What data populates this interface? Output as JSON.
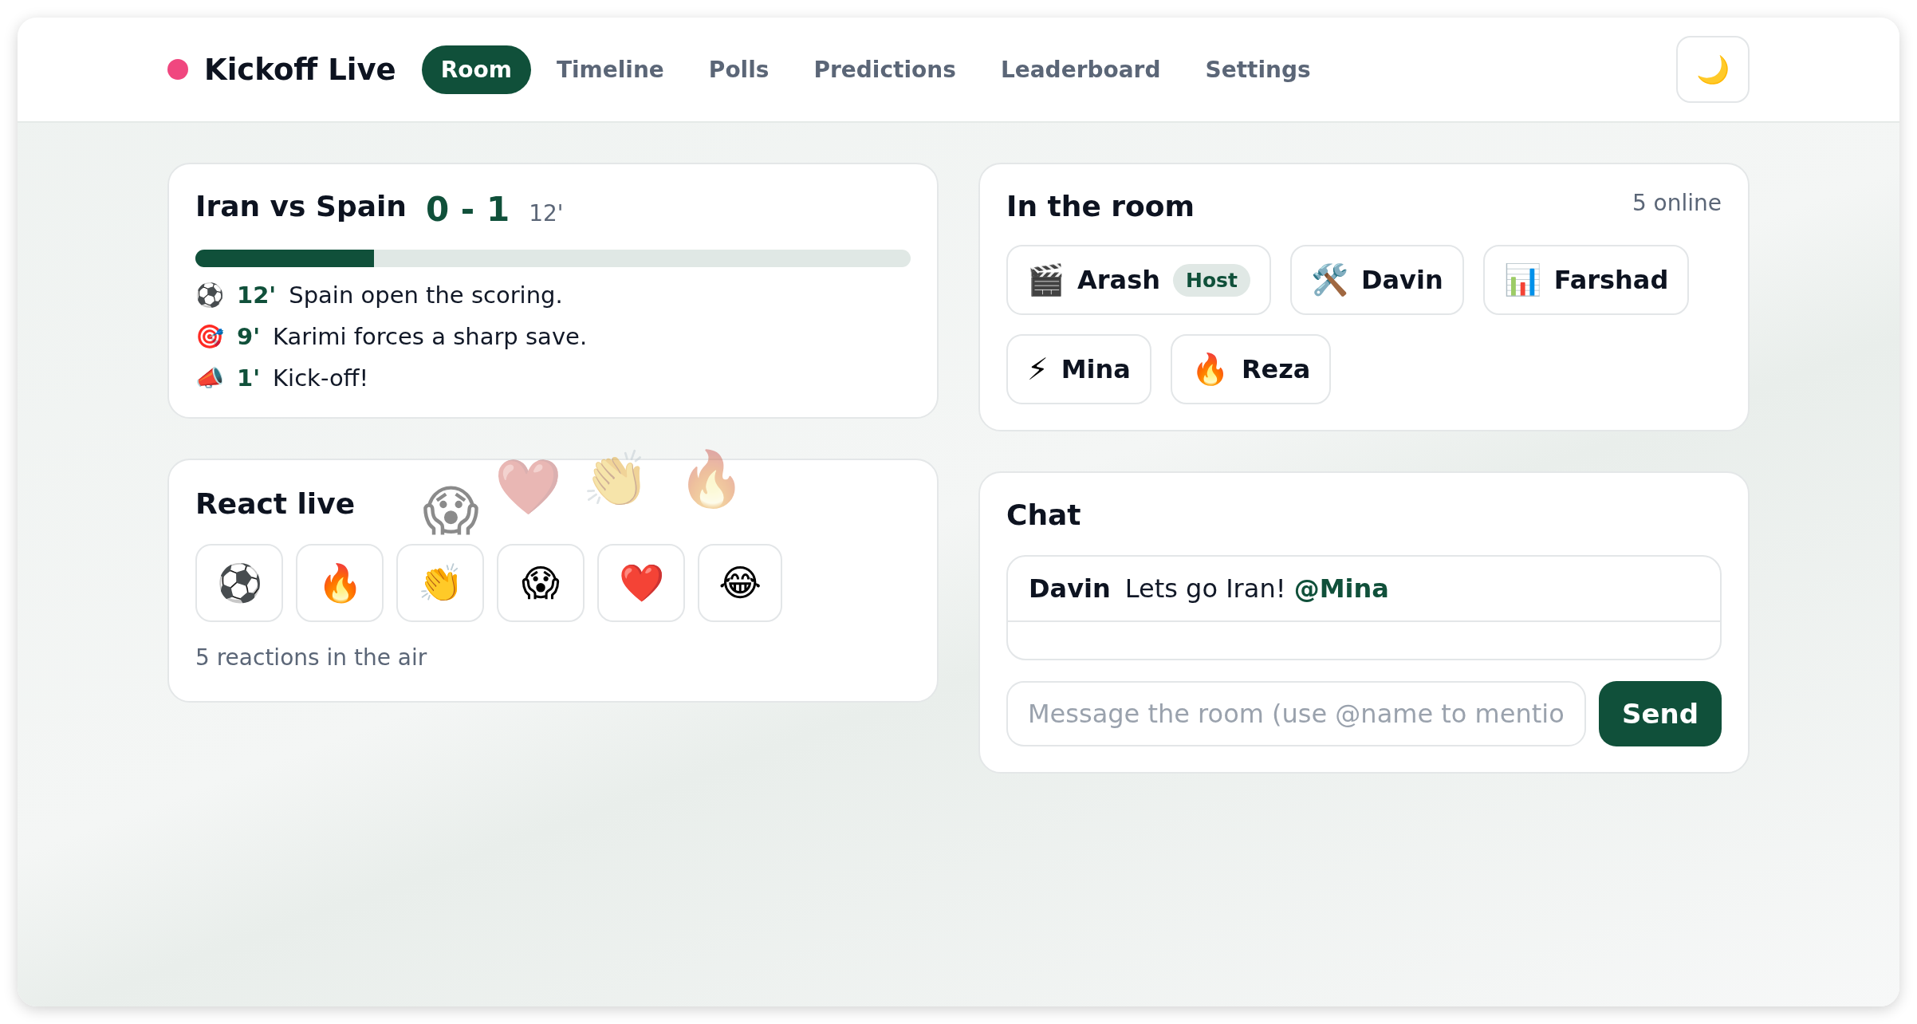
{
  "brand": {
    "name": "Kickoff Live"
  },
  "tabs": [
    {
      "label": "Room",
      "selected": true
    },
    {
      "label": "Timeline",
      "selected": false
    },
    {
      "label": "Polls",
      "selected": false
    },
    {
      "label": "Predictions",
      "selected": false
    },
    {
      "label": "Leaderboard",
      "selected": false
    },
    {
      "label": "Settings",
      "selected": false
    }
  ],
  "theme_toggle": {
    "icon": "🌙"
  },
  "match": {
    "title": "Iran vs Spain",
    "score": "0 - 1",
    "minute": "12'",
    "level": 0.25,
    "events": [
      {
        "icon": "⚽",
        "minute": "12'",
        "text": "Spain open the scoring."
      },
      {
        "icon": "🎯",
        "minute": "9'",
        "text": "Karimi forces a sharp save."
      },
      {
        "icon": "📣",
        "minute": "1'",
        "text": "Kick-off!"
      }
    ]
  },
  "reactions": {
    "title": "React live",
    "floating": [
      "😱",
      "❤️",
      "👏",
      "🔥"
    ],
    "buttons": [
      "⚽",
      "🔥",
      "👏",
      "😱",
      "❤️",
      "😂"
    ],
    "count": "5 reactions in the air"
  },
  "room": {
    "title": "In the room",
    "online": "5 online",
    "members": [
      {
        "icon": "🎬",
        "name": "Arash",
        "badge": "Host"
      },
      {
        "icon": "🛠️",
        "name": "Davin"
      },
      {
        "icon": "📊",
        "name": "Farshad"
      },
      {
        "icon": "⚡",
        "name": "Mina"
      },
      {
        "icon": "🔥",
        "name": "Reza"
      }
    ]
  },
  "chat": {
    "title": "Chat",
    "messages": [
      {
        "author": "Davin",
        "text": "Lets go Iran! **@Mina**"
      }
    ],
    "placeholder": "Message the room (use @name to mentio",
    "send": "Send"
  }
}
